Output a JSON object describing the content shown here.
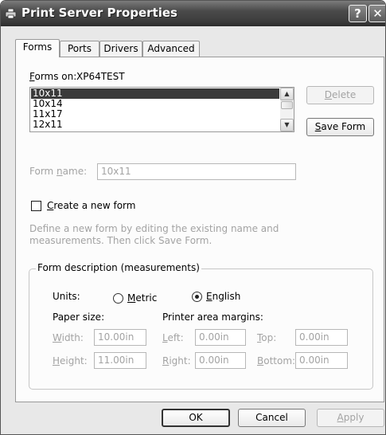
{
  "window": {
    "title": "Print Server Properties",
    "help_label": "?",
    "close_label": "✕"
  },
  "tabs": [
    {
      "label": "Forms",
      "active": true
    },
    {
      "label": "Ports",
      "active": false
    },
    {
      "label": "Drivers",
      "active": false
    },
    {
      "label": "Advanced",
      "active": false
    }
  ],
  "forms": {
    "forms_on_label": "Forms on:",
    "server_name": "XP64TEST",
    "list_items": [
      "10x11",
      "10x14",
      "11x17",
      "12x11"
    ],
    "selected_index": 0,
    "delete_label": "Delete",
    "save_form_label": "Save Form",
    "form_name_label": "Form name:",
    "form_name_value": "10x11",
    "create_new_label": "Create a new form",
    "create_new_checked": false,
    "hint_line1": "Define a new form by editing the existing name and",
    "hint_line2": "measurements.  Then click Save Form."
  },
  "measurements": {
    "group_title": "Form description (measurements)",
    "units_label": "Units:",
    "metric_label": "Metric",
    "english_label": "English",
    "selected_unit": "English",
    "paper_size_label": "Paper size:",
    "margins_label": "Printer area margins:",
    "width_label": "Width:",
    "width_value": "10.00in",
    "height_label": "Height:",
    "height_value": "11.00in",
    "left_label": "Left:",
    "left_value": "0.00in",
    "right_label": "Right:",
    "right_value": "0.00in",
    "top_label": "Top:",
    "top_value": "0.00in",
    "bottom_label": "Bottom:",
    "bottom_value": "0.00in"
  },
  "footer": {
    "ok_label": "OK",
    "cancel_label": "Cancel",
    "apply_label": "Apply"
  }
}
